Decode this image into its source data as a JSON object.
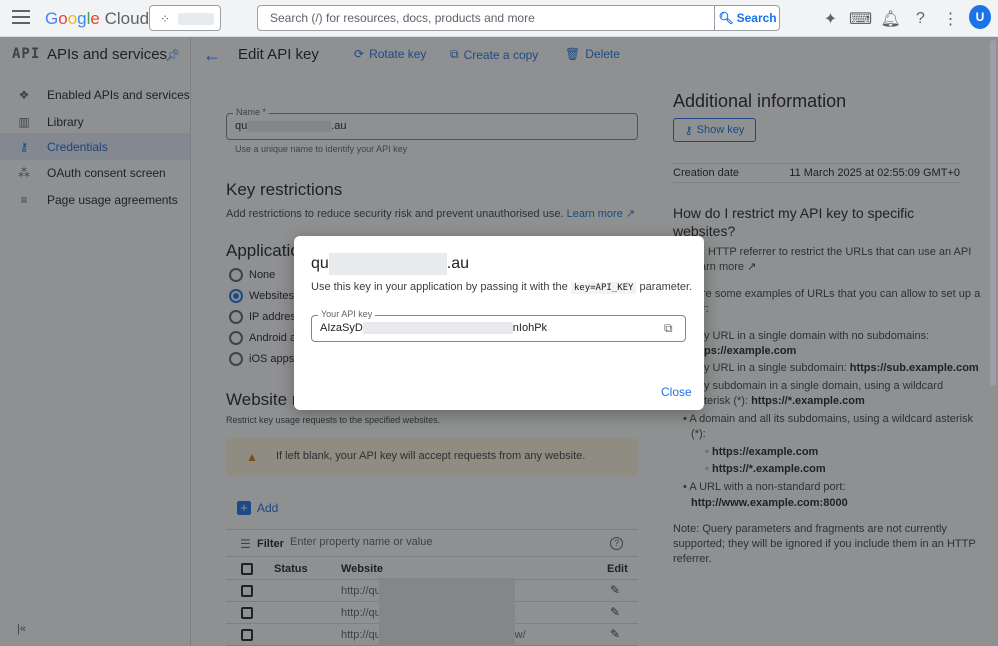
{
  "topbar": {
    "logo_parts": [
      "G",
      "o",
      "o",
      "g",
      "l",
      "e"
    ],
    "logo_suffix": "Cloud",
    "search_placeholder": "Search (/) for resources, docs, products and more",
    "search_button": "Search",
    "avatar_initial": "U"
  },
  "sidebar": {
    "logo_text": "API",
    "title": "APIs and services",
    "items": [
      {
        "label": "Enabled APIs and services",
        "icon": "diamond-grid-icon"
      },
      {
        "label": "Library",
        "icon": "library-icon"
      },
      {
        "label": "Credentials",
        "icon": "key-icon"
      },
      {
        "label": "OAuth consent screen",
        "icon": "oauth-icon"
      },
      {
        "label": "Page usage agreements",
        "icon": "settings-list-icon"
      }
    ]
  },
  "header": {
    "title": "Edit API key",
    "rotate": "Rotate key",
    "copy": "Create a copy",
    "delete": "Delete"
  },
  "form": {
    "name_label": "Name *",
    "name_prefix": "qu",
    "name_suffix": ".au",
    "name_hint": "Use a unique name to identify your API key",
    "key_restrictions_title": "Key restrictions",
    "key_restrictions_desc": "Add restrictions to reduce security risk and prevent unauthorised use.",
    "learn_more": "Learn more",
    "app_title": "Applicatio",
    "radios": [
      "None",
      "Websites",
      "IP addres",
      "Android a",
      "iOS apps"
    ],
    "website_title": "Website res",
    "website_desc": "Restrict key usage requests to the specified websites.",
    "warning": "If left blank, your API key will accept requests from any website.",
    "add": "Add",
    "filter_label": "Filter",
    "filter_placeholder": "Enter property name or value",
    "table_headers": [
      "Status",
      "Website",
      "Edit"
    ],
    "rows": [
      "http://qu",
      "http://qu",
      "http://quanscroastralia.org.au/andrew/"
    ]
  },
  "right": {
    "title": "Additional information",
    "show_key": "Show key",
    "creation_label": "Creation date",
    "creation_value": "11 March 2025 at 02:55:09 GMT+0",
    "question": "How do I restrict my API key to specific websites?",
    "p1a": "HTTP referrer to restrict the URLs that can use an API",
    "p1b": "arn more",
    "p2a": "re some examples of URLs that you can allow to set up a",
    "p2b": "r:",
    "b1a": "y URL in a single domain with no subdomains:",
    "b1b": "ps://example.com",
    "b2a": "y URL in a single subdomain:",
    "b2b": "https://sub.example.com",
    "b3a": "y subdomain in a single domain, using a wildcard",
    "b3b": "terisk (*):",
    "b3c": "https://*.example.com",
    "b4a": "A domain and all its subdomains, using a wildcard asterisk",
    "b4b": "(*):",
    "b4c": "https://example.com",
    "b4d": "https://*.example.com",
    "b5a": "A URL with a non-standard port:",
    "b5b": "http://www.example.com:8000",
    "note1": "Note: Query parameters and fragments are not currently",
    "note2": "supported; they will be ignored if you include them in an HTTP",
    "note3": "referrer."
  },
  "dialog": {
    "title_prefix": "qu",
    "title_suffix": ".au",
    "desc_before": "Use this key in your application by passing it with the",
    "desc_code": "key=API_KEY",
    "desc_after": "parameter.",
    "key_label": "Your API key",
    "key_prefix": "AIzaSyD",
    "key_suffix": "nIohPk",
    "close": "Close"
  },
  "colors": {
    "accent": "#1a73e8",
    "active_bg": "#e8f0fe",
    "warning_bg": "#fef7e0"
  }
}
